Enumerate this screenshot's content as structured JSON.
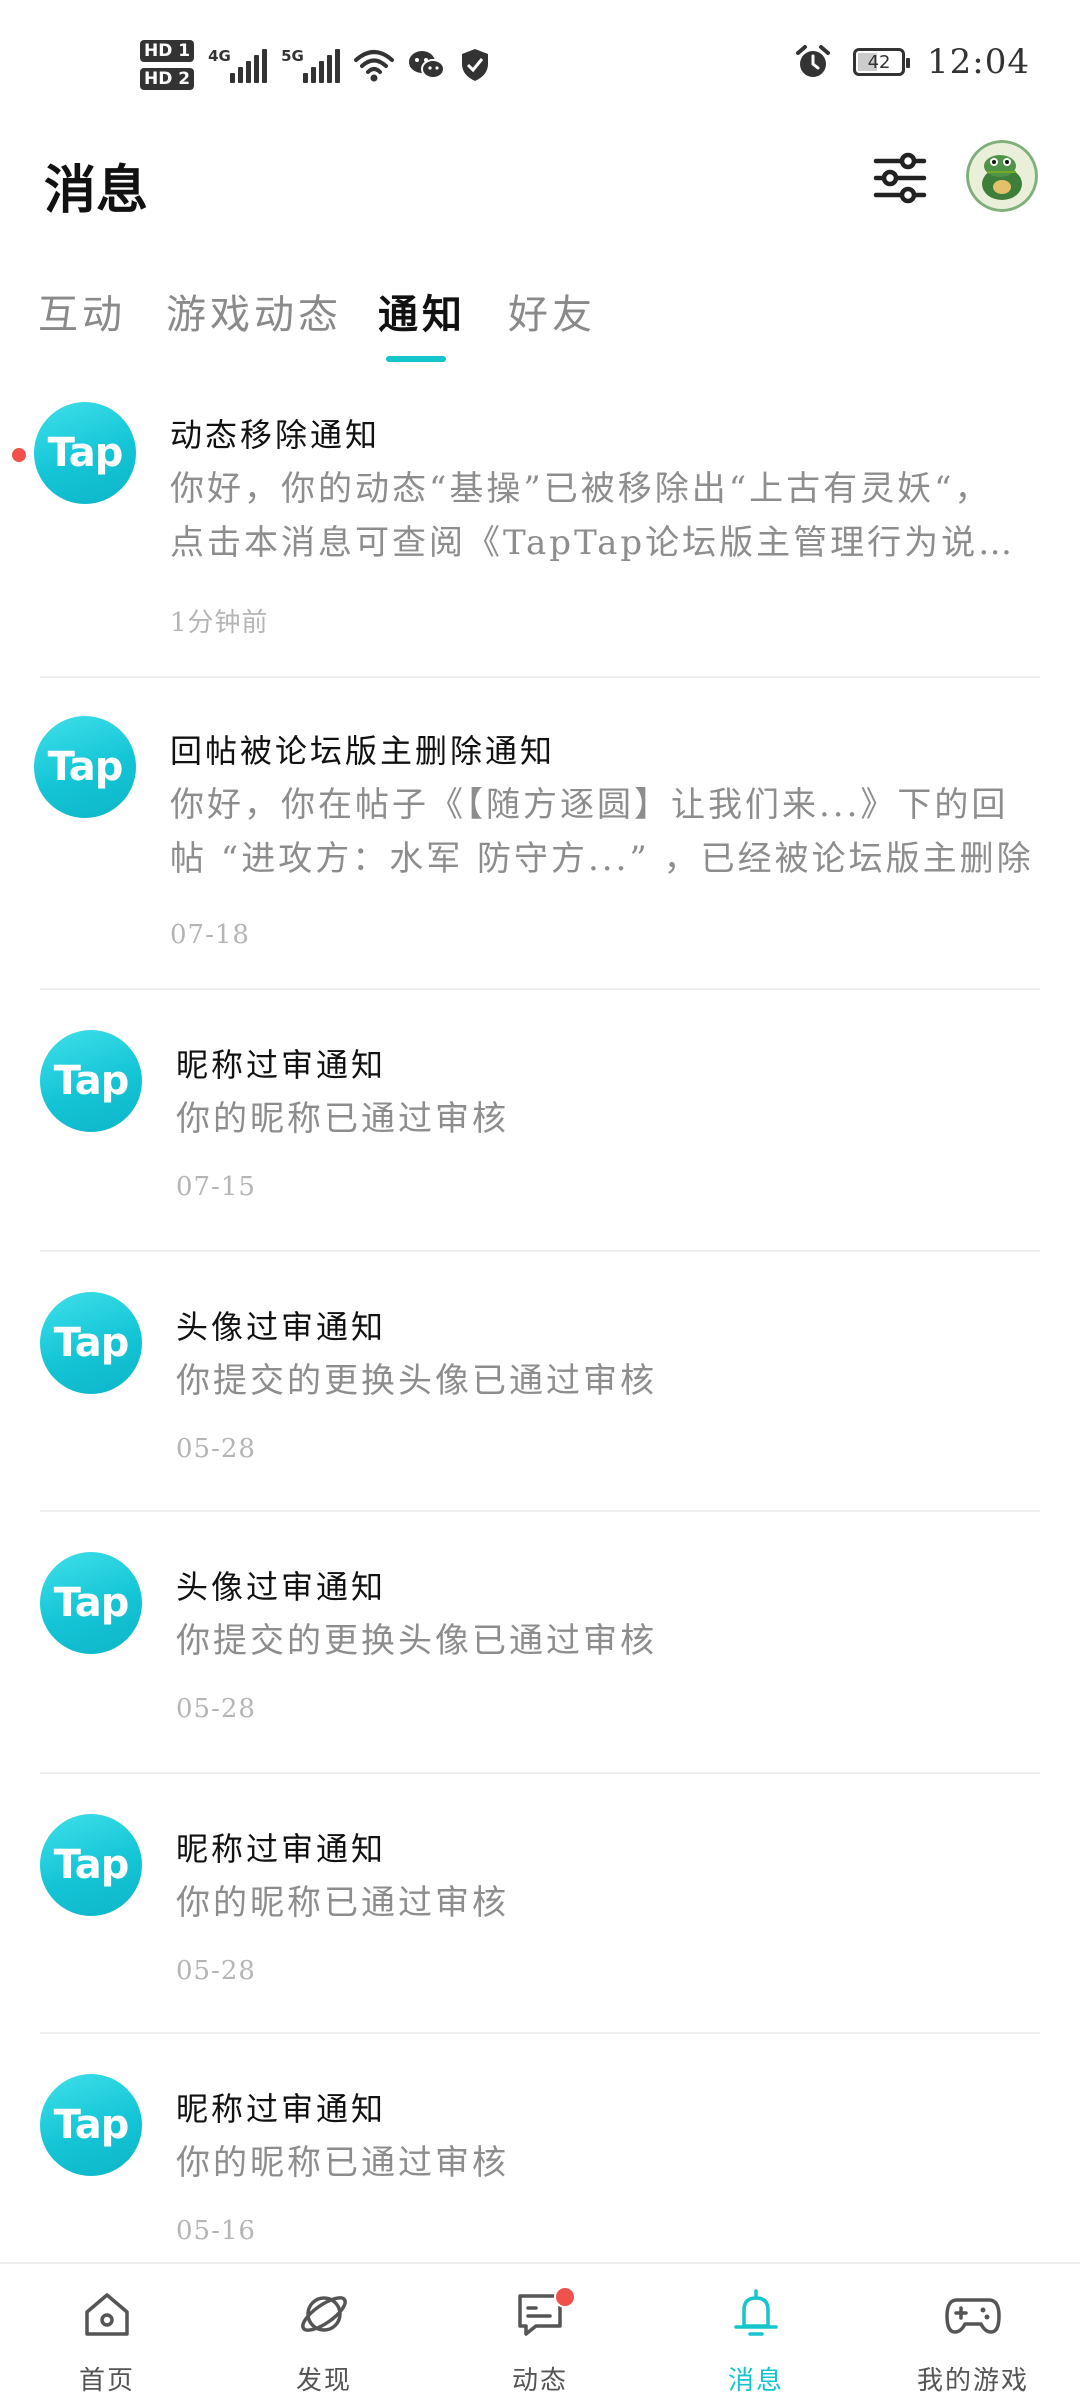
{
  "status_bar": {
    "hd1": "HD 1",
    "hd2": "HD 2",
    "net1": "4G",
    "net2": "5G",
    "battery": "42",
    "battery_level": 0.42,
    "time": "12:04"
  },
  "header": {
    "title": "消息"
  },
  "tabs": [
    {
      "label": "互动",
      "active": false
    },
    {
      "label": "游戏动态",
      "active": false
    },
    {
      "label": "通知",
      "active": true
    },
    {
      "label": "好友",
      "active": false
    }
  ],
  "notifications": [
    {
      "logo": "Tap",
      "title": "动态移除通知",
      "body_line1": "你好，你的动态“基操”已被移除出“上古有灵妖“，",
      "body_line2": "点击本消息可查阅《TapTap论坛版主管理行为说明》",
      "time": "1分钟前",
      "unread": true
    },
    {
      "logo": "Tap",
      "title": "回帖被论坛版主删除通知",
      "body_line1": "你好，你在帖子《【随方逐圆】让我们来...》下的回",
      "body_line2": "帖 “进攻方：水军 防守方...” ，已经被论坛版主删除",
      "time": "07-18",
      "unread": false
    },
    {
      "logo": "Tap",
      "title": "昵称过审通知",
      "body_line1": "你的昵称已通过审核",
      "time": "07-15",
      "unread": false
    },
    {
      "logo": "Tap",
      "title": "头像过审通知",
      "body_line1": "你提交的更换头像已通过审核",
      "time": "05-28",
      "unread": false
    },
    {
      "logo": "Tap",
      "title": "头像过审通知",
      "body_line1": "你提交的更换头像已通过审核",
      "time": "05-28",
      "unread": false
    },
    {
      "logo": "Tap",
      "title": "昵称过审通知",
      "body_line1": "你的昵称已通过审核",
      "time": "05-28",
      "unread": false
    },
    {
      "logo": "Tap",
      "title": "昵称过审通知",
      "body_line1": "你的昵称已通过审核",
      "time": "05-16",
      "unread": false
    }
  ],
  "bottom_nav": [
    {
      "label": "首页",
      "icon": "home-icon",
      "active": false
    },
    {
      "label": "发现",
      "icon": "planet-icon",
      "active": false
    },
    {
      "label": "动态",
      "icon": "chat-icon",
      "active": false,
      "badge": true
    },
    {
      "label": "消息",
      "icon": "bell-icon",
      "active": true
    },
    {
      "label": "我的游戏",
      "icon": "gamepad-icon",
      "active": false
    }
  ],
  "colors": {
    "accent": "#15c5ce",
    "badge": "#f0524b",
    "muted_text": "#8d8d8d"
  }
}
